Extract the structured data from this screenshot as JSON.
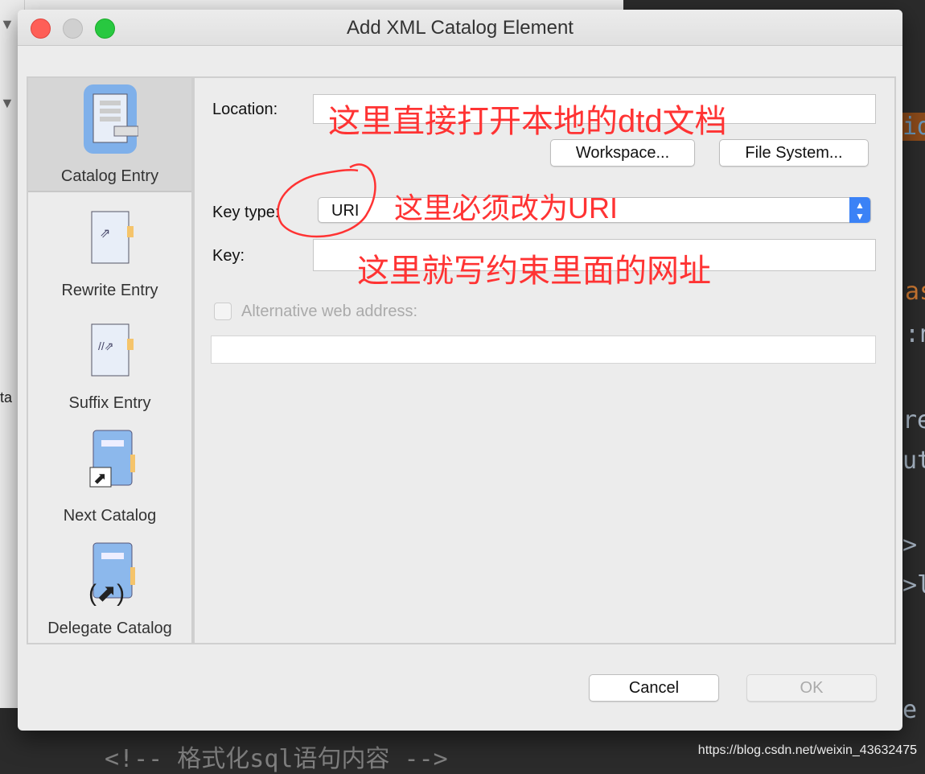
{
  "dialog": {
    "title": "Add XML Catalog Element"
  },
  "sidebar": {
    "items": [
      {
        "label": "Catalog Entry",
        "selected": true
      },
      {
        "label": "Rewrite Entry"
      },
      {
        "label": "Suffix Entry"
      },
      {
        "label": "Next Catalog"
      },
      {
        "label": "Delegate Catalog"
      }
    ]
  },
  "form": {
    "location_label": "Location:",
    "location_value": "",
    "workspace_button": "Workspace...",
    "filesystem_button": "File System...",
    "keytype_label": "Key type:",
    "keytype_value": "URI",
    "key_label": "Key:",
    "key_value": "",
    "alt_label": "Alternative web address:",
    "alt_checked": false,
    "alt_value": ""
  },
  "buttons": {
    "cancel": "Cancel",
    "ok": "OK"
  },
  "annotations": {
    "location": "这里直接打开本地的dtd文档",
    "keytype": "这里必须改为URI",
    "key": "这里就写约束里面的网址"
  },
  "background": {
    "code_bottom": "<!-- 格式化sql语句内容 -->",
    "side_text": "ta",
    "right_code": [
      "id",
      "as",
      ":n",
      "re",
      "ut",
      ">",
      ">l",
      "e"
    ],
    "watermark": "https://blog.csdn.net/weixin_43632475"
  },
  "colors": {
    "close": "#fe5f57",
    "minimize": "#d0d0d0",
    "zoom": "#28c840",
    "annotation": "#ff3333",
    "accent": "#3b82f6"
  }
}
